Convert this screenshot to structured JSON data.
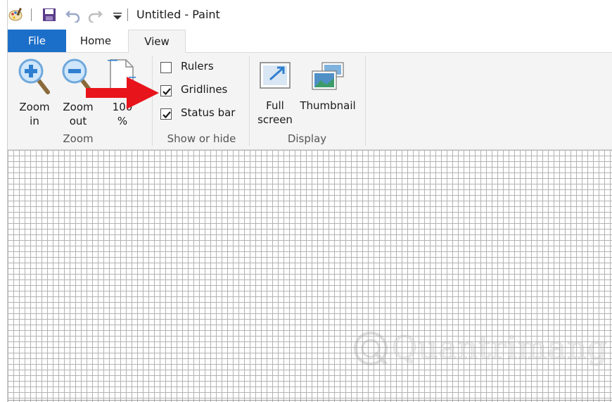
{
  "window": {
    "title": "Untitled - Paint"
  },
  "quick_access": {
    "icons": [
      "paint-app-icon",
      "save-icon",
      "undo-icon",
      "redo-icon",
      "customize-qat-icon"
    ]
  },
  "tabs": [
    {
      "label": "File",
      "active": false
    },
    {
      "label": "Home",
      "active": false
    },
    {
      "label": "View",
      "active": true
    }
  ],
  "ribbon": {
    "zoom_group": {
      "label": "Zoom",
      "buttons": [
        {
          "label": "Zoom\nin",
          "icon": "zoom-in-icon"
        },
        {
          "label": "Zoom\nout",
          "icon": "zoom-out-icon"
        },
        {
          "label": "100\n%",
          "icon": "actual-size-icon"
        }
      ]
    },
    "show_hide_group": {
      "label": "Show or hide",
      "options": [
        {
          "label": "Rulers",
          "checked": false
        },
        {
          "label": "Gridlines",
          "checked": true
        },
        {
          "label": "Status bar",
          "checked": true
        }
      ]
    },
    "display_group": {
      "label": "Display",
      "buttons": [
        {
          "label": "Full\nscreen",
          "icon": "full-screen-icon"
        },
        {
          "label": "Thumbnail",
          "icon": "thumbnail-icon"
        }
      ]
    }
  },
  "annotation": {
    "arrow_color": "#e8141b",
    "points_to": "Gridlines"
  },
  "watermark": {
    "text": "Quantrimang"
  },
  "colors": {
    "file_tab": "#1c6fc9",
    "ribbon_bg": "#f4f4f4",
    "gridline": "#b3b3b3"
  }
}
